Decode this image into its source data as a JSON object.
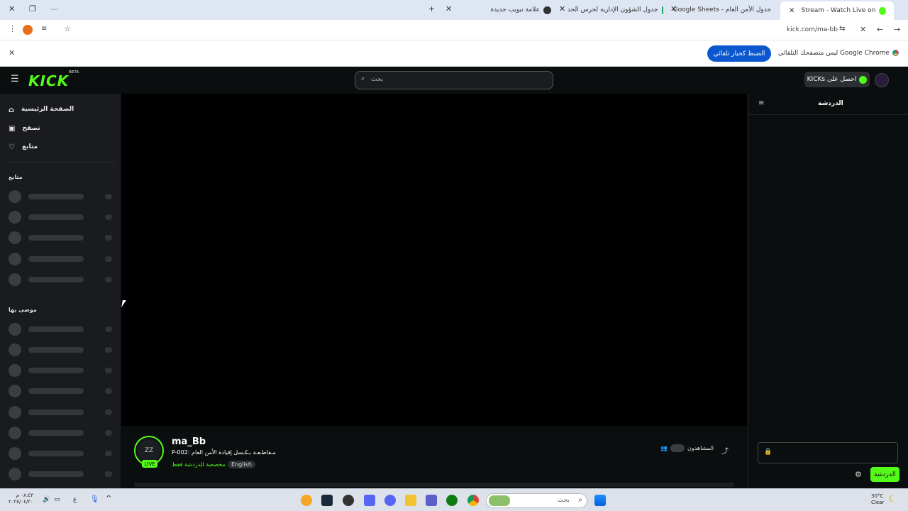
{
  "browser": {
    "tabs": [
      {
        "label": "ma_Bb Stream - Watch Live on",
        "active": true
      },
      {
        "label": "جدول الأمن العام - Google Sheets",
        "active": false
      },
      {
        "label": "جدول الشؤون الإدارية لحرس الحد",
        "active": false
      },
      {
        "label": "علامة تبويب جديدة",
        "active": false
      }
    ],
    "url": "kick.com/ma-bb",
    "infobar_text": "Google Chrome ليس متصفحك التلقائي",
    "infobar_button": "الضبط كخيار تلقائي"
  },
  "kick": {
    "logo_text": "KICK",
    "logo_badge": "BETA",
    "search_placeholder": "بحث",
    "get_kicks": "احصل على KICKs",
    "sidebar": {
      "nav": [
        {
          "label": "الصفحة الرئيسية",
          "icon": "home-icon"
        },
        {
          "label": "تصفح",
          "icon": "browse-icon"
        },
        {
          "label": "متابع",
          "icon": "heart-icon"
        }
      ],
      "following_heading": "متابع",
      "recommended_heading": "موصى بها"
    },
    "stream": {
      "username": "ma_Bb",
      "avatar_text": "ZZ",
      "live_badge": "LIVE",
      "title": "P-002: مـقاطـعـة بـكـسل إقيادة الأمن العام",
      "subs_only": "مخصصة للدردشة فقط",
      "language": "English",
      "viewers_label": "المشاهدون"
    },
    "chat": {
      "title": "الدردشة",
      "send_button": "الدردشة"
    }
  },
  "taskbar": {
    "search_placeholder": "بحث",
    "time": "٠٨:٤٣ م",
    "date": "٢٠٢٥/٠٤/٢٠",
    "weather_temp": "30°C",
    "weather_desc": "Clear",
    "lang": "ع"
  },
  "colors": {
    "kick_green": "#53fc18",
    "chrome_blue": "#0b57d0"
  }
}
